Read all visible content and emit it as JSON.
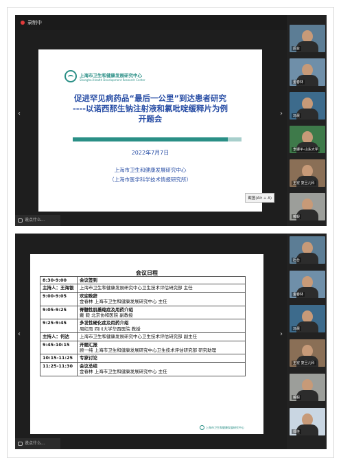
{
  "top": {
    "recording_label": "录制中",
    "slide": {
      "org_logo_cn": "上海市卫生和健康发展研究中心",
      "org_logo_en": "Shanghai Health Development Research Center",
      "title_line1": "促进罕见病药品“最后一公里”到达患者研究",
      "title_line2": "----以诺西那生钠注射液和氯吡啶缓释片为例",
      "title_line3": "开题会",
      "date": "2022年7月7日",
      "org1": "上海市卫生和健康发展研究中心",
      "org2": "（上海市医学科学技术情报研究所）"
    },
    "screenshot_btn": "截图(Alt + A)",
    "say_input": "说点什么...",
    "participants": [
      {
        "name": "后台"
      },
      {
        "name": "金春林"
      },
      {
        "name": "冯晨"
      },
      {
        "name": "李娜平-山东大学"
      },
      {
        "name": "王宏 复旦儿科"
      },
      {
        "name": "戴毅"
      }
    ]
  },
  "bottom": {
    "say_input": "说点什么...",
    "agenda": {
      "title": "会议日程",
      "rows": [
        {
          "time": "8:30-9:00",
          "content": "会议签到",
          "bold": true
        },
        {
          "time": "主持人：王海银",
          "content": "上海市卫生和健康发展研究中心卫生技术评估研究部 主任",
          "bold": false
        },
        {
          "time": "9:00-9:05",
          "content": "欢迎致辞",
          "sub": "金春林  上海市卫生和健康发展研究中心  主任",
          "bold": true
        },
        {
          "time": "9:05-9:25",
          "content": "脊髓性肌萎缩症及用药介绍",
          "sub": "戴  毅  北京协和医院  副教授",
          "bold": true
        },
        {
          "time": "9:25-9:45",
          "content": "多发性硬化症及用药介绍",
          "sub": "周红雨  四川大学华西医院  教授",
          "bold": true
        },
        {
          "time": "主持人：何达",
          "content": "上海市卫生和健康发展研究中心卫生技术评估研究部 副主任",
          "bold": false
        },
        {
          "time": "9:45-10:15",
          "content": "开题汇报",
          "sub": "顾一纯  上海市卫生和健康发展研究中心卫生技术评估研究部 研究助理",
          "bold": true
        },
        {
          "time": "10:15-11:25",
          "content": "专家讨论",
          "bold": true
        },
        {
          "time": "11:25-11:30",
          "content": "会议总结",
          "sub": "金春林  上海市卫生和健康发展研究中心  主任",
          "bold": true
        }
      ]
    },
    "participants": [
      {
        "name": "后台"
      },
      {
        "name": "金春林"
      },
      {
        "name": "冯晨"
      },
      {
        "name": "王宏 复旦儿科"
      },
      {
        "name": "戴毅"
      },
      {
        "name": "郑佳"
      }
    ]
  }
}
